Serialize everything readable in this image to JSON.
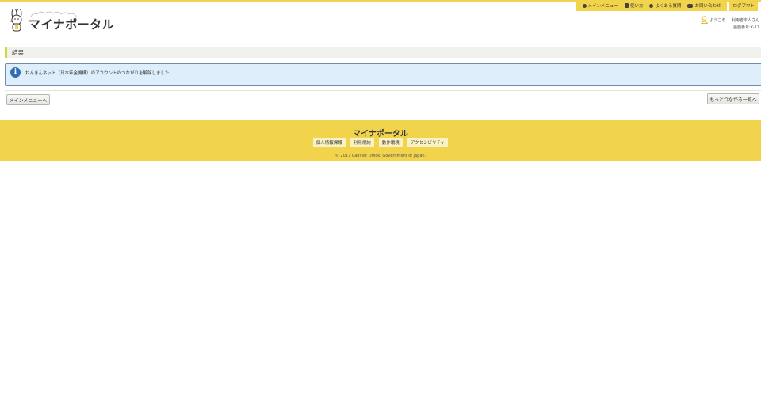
{
  "header": {
    "logo_text": "マイナポータル",
    "nav": [
      {
        "label": "メインメニュー",
        "icon": "arrow-circle-icon"
      },
      {
        "label": "使い方",
        "icon": "book-icon"
      },
      {
        "label": "よくある質問",
        "icon": "question-icon"
      },
      {
        "label": "お問い合わせ",
        "icon": "chat-icon"
      }
    ],
    "logout_label": "ログアウト",
    "welcome": "ようこそ",
    "username": "利用者本人さん",
    "screen_id": "画面番号:X-17"
  },
  "section": {
    "title": "結果"
  },
  "info": {
    "message": "ねんきんネット（日本年金機構）のアカウントのつながりを解除しました。"
  },
  "buttons": {
    "main_menu": "メインメニューへ",
    "connection_list": "もっとつながる一覧へ"
  },
  "footer": {
    "title": "マイナポータル",
    "links": [
      "個人情報保護",
      "利用規約",
      "動作環境",
      "アクセシビリティ"
    ],
    "copyright": "© 2017 Cabinet Office, Government of Japan."
  },
  "colors": {
    "brand_yellow": "#f2d44c",
    "info_blue": "#2f6fb4",
    "accent_green": "#c8dc3c"
  }
}
